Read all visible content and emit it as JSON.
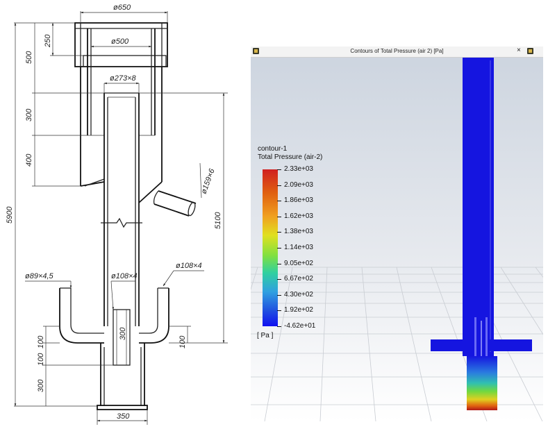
{
  "drawing": {
    "dimensions": {
      "d650": "ø650",
      "d500": "ø500",
      "d273": "ø273×8",
      "d159": "ø159×6",
      "d89": "ø89×4,5",
      "d108a": "ø108×4",
      "d108b": "ø108×4",
      "h250": "250",
      "h500": "500",
      "h300a": "300",
      "h400": "400",
      "h5900": "5900",
      "h5100": "5100",
      "h300b": "300",
      "h100a": "100",
      "h100b": "100",
      "h100c": "100",
      "h300c": "300",
      "w350": "350"
    }
  },
  "viewer": {
    "window_title": "Contours of Total Pressure (air 2)  [Pa]",
    "close_symbol": "×",
    "legend": {
      "name": "contour-1",
      "quantity": "Total Pressure (air-2)",
      "units": "[ Pa ]",
      "values": [
        "2.33e+03",
        "2.09e+03",
        "1.86e+03",
        "1.62e+03",
        "1.38e+03",
        "1.14e+03",
        "9.05e+02",
        "6.67e+02",
        "4.30e+02",
        "1.92e+02",
        "-4.62e+01"
      ]
    },
    "colors": {
      "uniform_flow": "#1515e0",
      "max_pressure": "#d02020"
    }
  }
}
